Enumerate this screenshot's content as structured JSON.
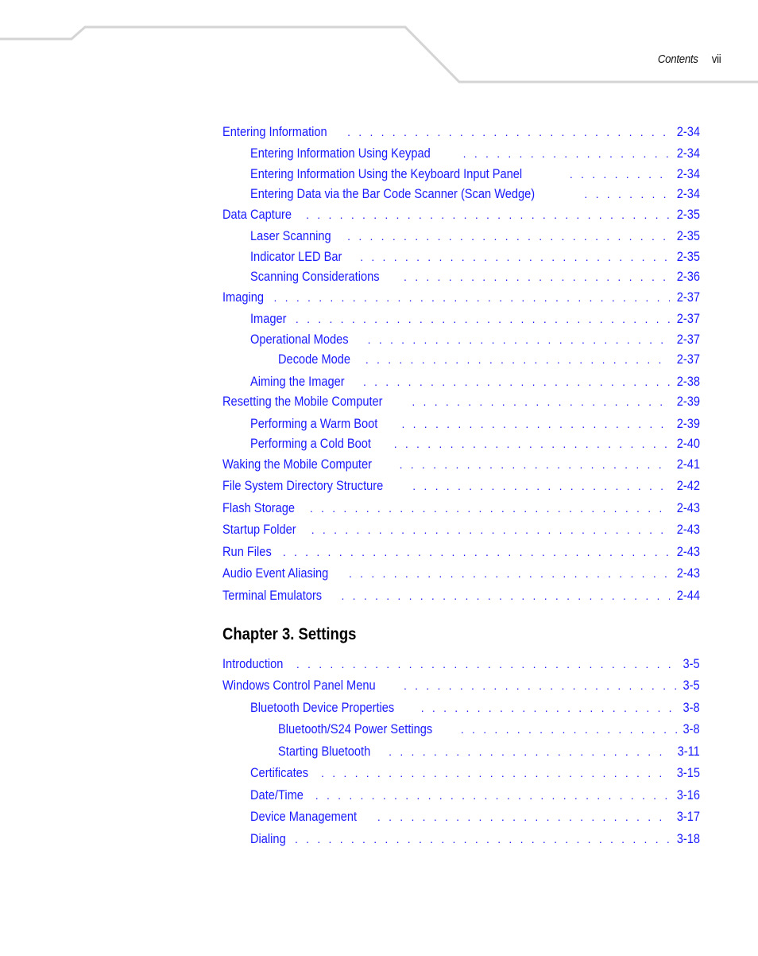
{
  "running_head": {
    "section": "Contents",
    "page": "vii"
  },
  "toc_before": [
    {
      "title": "Entering Information",
      "page": "2-34",
      "level": 1
    },
    {
      "title": "Entering Information Using Keypad",
      "page": "2-34",
      "level": 2
    },
    {
      "title": "Entering Information Using the Keyboard Input Panel",
      "page": "2-34",
      "level": 2
    },
    {
      "title": "Entering Data via the Bar Code Scanner (Scan Wedge)",
      "page": "2-34",
      "level": 2
    },
    {
      "title": "Data Capture",
      "page": "2-35",
      "level": 1
    },
    {
      "title": "Laser Scanning",
      "page": "2-35",
      "level": 2
    },
    {
      "title": "Indicator LED Bar",
      "page": "2-35",
      "level": 2
    },
    {
      "title": "Scanning Considerations",
      "page": "2-36",
      "level": 2
    },
    {
      "title": "Imaging",
      "page": "2-37",
      "level": 1
    },
    {
      "title": "Imager",
      "page": "2-37",
      "level": 2
    },
    {
      "title": "Operational Modes",
      "page": "2-37",
      "level": 2
    },
    {
      "title": "Decode Mode",
      "page": "2-37",
      "level": 3
    },
    {
      "title": "Aiming the Imager",
      "page": "2-38",
      "level": 2
    },
    {
      "title": "Resetting the Mobile Computer",
      "page": "2-39",
      "level": 1
    },
    {
      "title": "Performing a Warm Boot",
      "page": "2-39",
      "level": 2
    },
    {
      "title": "Performing a Cold Boot",
      "page": "2-40",
      "level": 2
    },
    {
      "title": "Waking the Mobile Computer",
      "page": "2-41",
      "level": 1
    },
    {
      "title": "File System Directory Structure",
      "page": "2-42",
      "level": 1
    },
    {
      "title": "Flash Storage",
      "page": "2-43",
      "level": 1
    },
    {
      "title": "Startup Folder",
      "page": "2-43",
      "level": 1
    },
    {
      "title": "Run Files",
      "page": "2-43",
      "level": 1
    },
    {
      "title": "Audio Event Aliasing",
      "page": "2-43",
      "level": 1
    },
    {
      "title": "Terminal Emulators",
      "page": "2-44",
      "level": 1
    }
  ],
  "chapter": {
    "title": "Chapter 3. Settings"
  },
  "toc_after": [
    {
      "title": "Introduction",
      "page": "3-5",
      "level": 1
    },
    {
      "title": "Windows Control Panel Menu",
      "page": "3-5",
      "level": 1
    },
    {
      "title": "Bluetooth Device Properties",
      "page": "3-8",
      "level": 2
    },
    {
      "title": "Bluetooth/S24 Power Settings",
      "page": "3-8",
      "level": 3
    },
    {
      "title": "Starting Bluetooth",
      "page": "3-11",
      "level": 3
    },
    {
      "title": "Certificates",
      "page": "3-15",
      "level": 2
    },
    {
      "title": "Date/Time",
      "page": "3-16",
      "level": 2
    },
    {
      "title": "Device Management",
      "page": "3-17",
      "level": 2
    },
    {
      "title": "Dialing",
      "page": "3-18",
      "level": 2
    }
  ]
}
